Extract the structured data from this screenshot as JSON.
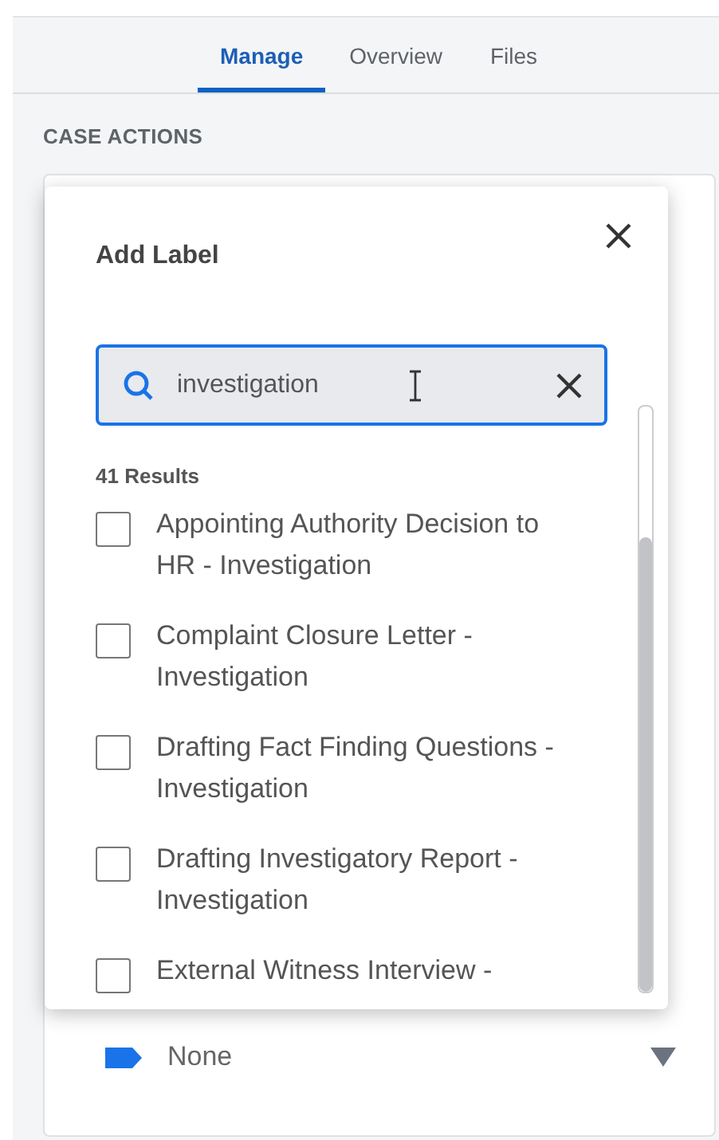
{
  "tabs": [
    {
      "label": "Manage",
      "selected": true
    },
    {
      "label": "Overview",
      "selected": false
    },
    {
      "label": "Files",
      "selected": false
    }
  ],
  "section_title": "CASE ACTIONS",
  "label_select": {
    "value": "None"
  },
  "dialog": {
    "title": "Add Label",
    "search": {
      "value": "investigation"
    },
    "results_count": "41 Results",
    "options": [
      {
        "label": "Appointing Authority Decision to HR - Investigation",
        "checked": false
      },
      {
        "label": "Complaint Closure Letter - Investigation",
        "checked": false
      },
      {
        "label": "Drafting Fact Finding Questions - Investigation",
        "checked": false
      },
      {
        "label": "Drafting Investigatory Report - Investigation",
        "checked": false
      },
      {
        "label": "External Witness Interview -",
        "checked": false
      }
    ]
  }
}
